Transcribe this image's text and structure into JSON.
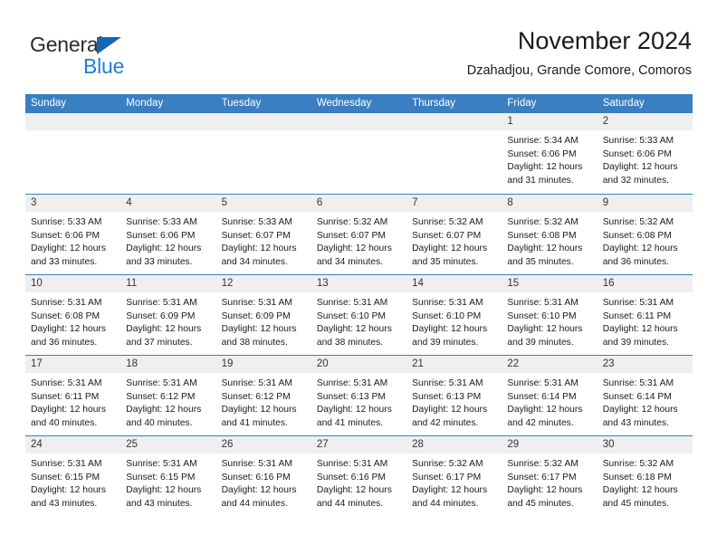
{
  "brand": {
    "name_part1": "General",
    "name_part2": "Blue",
    "triangle_color": "#1667b3",
    "blue_color": "#1f7fd4"
  },
  "header": {
    "title": "November 2024",
    "subtitle": "Dzahadjou, Grande Comore, Comoros"
  },
  "theme": {
    "header_bar_color": "#3a7fc1",
    "day_band_color": "#efefef",
    "row_divider_color": "#3a7fc1"
  },
  "weekdays": [
    "Sunday",
    "Monday",
    "Tuesday",
    "Wednesday",
    "Thursday",
    "Friday",
    "Saturday"
  ],
  "weeks": [
    [
      {
        "day": "",
        "lines": []
      },
      {
        "day": "",
        "lines": []
      },
      {
        "day": "",
        "lines": []
      },
      {
        "day": "",
        "lines": []
      },
      {
        "day": "",
        "lines": []
      },
      {
        "day": "1",
        "lines": [
          "Sunrise: 5:34 AM",
          "Sunset: 6:06 PM",
          "Daylight: 12 hours",
          "and 31 minutes."
        ]
      },
      {
        "day": "2",
        "lines": [
          "Sunrise: 5:33 AM",
          "Sunset: 6:06 PM",
          "Daylight: 12 hours",
          "and 32 minutes."
        ]
      }
    ],
    [
      {
        "day": "3",
        "lines": [
          "Sunrise: 5:33 AM",
          "Sunset: 6:06 PM",
          "Daylight: 12 hours",
          "and 33 minutes."
        ]
      },
      {
        "day": "4",
        "lines": [
          "Sunrise: 5:33 AM",
          "Sunset: 6:06 PM",
          "Daylight: 12 hours",
          "and 33 minutes."
        ]
      },
      {
        "day": "5",
        "lines": [
          "Sunrise: 5:33 AM",
          "Sunset: 6:07 PM",
          "Daylight: 12 hours",
          "and 34 minutes."
        ]
      },
      {
        "day": "6",
        "lines": [
          "Sunrise: 5:32 AM",
          "Sunset: 6:07 PM",
          "Daylight: 12 hours",
          "and 34 minutes."
        ]
      },
      {
        "day": "7",
        "lines": [
          "Sunrise: 5:32 AM",
          "Sunset: 6:07 PM",
          "Daylight: 12 hours",
          "and 35 minutes."
        ]
      },
      {
        "day": "8",
        "lines": [
          "Sunrise: 5:32 AM",
          "Sunset: 6:08 PM",
          "Daylight: 12 hours",
          "and 35 minutes."
        ]
      },
      {
        "day": "9",
        "lines": [
          "Sunrise: 5:32 AM",
          "Sunset: 6:08 PM",
          "Daylight: 12 hours",
          "and 36 minutes."
        ]
      }
    ],
    [
      {
        "day": "10",
        "lines": [
          "Sunrise: 5:31 AM",
          "Sunset: 6:08 PM",
          "Daylight: 12 hours",
          "and 36 minutes."
        ]
      },
      {
        "day": "11",
        "lines": [
          "Sunrise: 5:31 AM",
          "Sunset: 6:09 PM",
          "Daylight: 12 hours",
          "and 37 minutes."
        ]
      },
      {
        "day": "12",
        "lines": [
          "Sunrise: 5:31 AM",
          "Sunset: 6:09 PM",
          "Daylight: 12 hours",
          "and 38 minutes."
        ]
      },
      {
        "day": "13",
        "lines": [
          "Sunrise: 5:31 AM",
          "Sunset: 6:10 PM",
          "Daylight: 12 hours",
          "and 38 minutes."
        ]
      },
      {
        "day": "14",
        "lines": [
          "Sunrise: 5:31 AM",
          "Sunset: 6:10 PM",
          "Daylight: 12 hours",
          "and 39 minutes."
        ]
      },
      {
        "day": "15",
        "lines": [
          "Sunrise: 5:31 AM",
          "Sunset: 6:10 PM",
          "Daylight: 12 hours",
          "and 39 minutes."
        ]
      },
      {
        "day": "16",
        "lines": [
          "Sunrise: 5:31 AM",
          "Sunset: 6:11 PM",
          "Daylight: 12 hours",
          "and 39 minutes."
        ]
      }
    ],
    [
      {
        "day": "17",
        "lines": [
          "Sunrise: 5:31 AM",
          "Sunset: 6:11 PM",
          "Daylight: 12 hours",
          "and 40 minutes."
        ]
      },
      {
        "day": "18",
        "lines": [
          "Sunrise: 5:31 AM",
          "Sunset: 6:12 PM",
          "Daylight: 12 hours",
          "and 40 minutes."
        ]
      },
      {
        "day": "19",
        "lines": [
          "Sunrise: 5:31 AM",
          "Sunset: 6:12 PM",
          "Daylight: 12 hours",
          "and 41 minutes."
        ]
      },
      {
        "day": "20",
        "lines": [
          "Sunrise: 5:31 AM",
          "Sunset: 6:13 PM",
          "Daylight: 12 hours",
          "and 41 minutes."
        ]
      },
      {
        "day": "21",
        "lines": [
          "Sunrise: 5:31 AM",
          "Sunset: 6:13 PM",
          "Daylight: 12 hours",
          "and 42 minutes."
        ]
      },
      {
        "day": "22",
        "lines": [
          "Sunrise: 5:31 AM",
          "Sunset: 6:14 PM",
          "Daylight: 12 hours",
          "and 42 minutes."
        ]
      },
      {
        "day": "23",
        "lines": [
          "Sunrise: 5:31 AM",
          "Sunset: 6:14 PM",
          "Daylight: 12 hours",
          "and 43 minutes."
        ]
      }
    ],
    [
      {
        "day": "24",
        "lines": [
          "Sunrise: 5:31 AM",
          "Sunset: 6:15 PM",
          "Daylight: 12 hours",
          "and 43 minutes."
        ]
      },
      {
        "day": "25",
        "lines": [
          "Sunrise: 5:31 AM",
          "Sunset: 6:15 PM",
          "Daylight: 12 hours",
          "and 43 minutes."
        ]
      },
      {
        "day": "26",
        "lines": [
          "Sunrise: 5:31 AM",
          "Sunset: 6:16 PM",
          "Daylight: 12 hours",
          "and 44 minutes."
        ]
      },
      {
        "day": "27",
        "lines": [
          "Sunrise: 5:31 AM",
          "Sunset: 6:16 PM",
          "Daylight: 12 hours",
          "and 44 minutes."
        ]
      },
      {
        "day": "28",
        "lines": [
          "Sunrise: 5:32 AM",
          "Sunset: 6:17 PM",
          "Daylight: 12 hours",
          "and 44 minutes."
        ]
      },
      {
        "day": "29",
        "lines": [
          "Sunrise: 5:32 AM",
          "Sunset: 6:17 PM",
          "Daylight: 12 hours",
          "and 45 minutes."
        ]
      },
      {
        "day": "30",
        "lines": [
          "Sunrise: 5:32 AM",
          "Sunset: 6:18 PM",
          "Daylight: 12 hours",
          "and 45 minutes."
        ]
      }
    ]
  ]
}
